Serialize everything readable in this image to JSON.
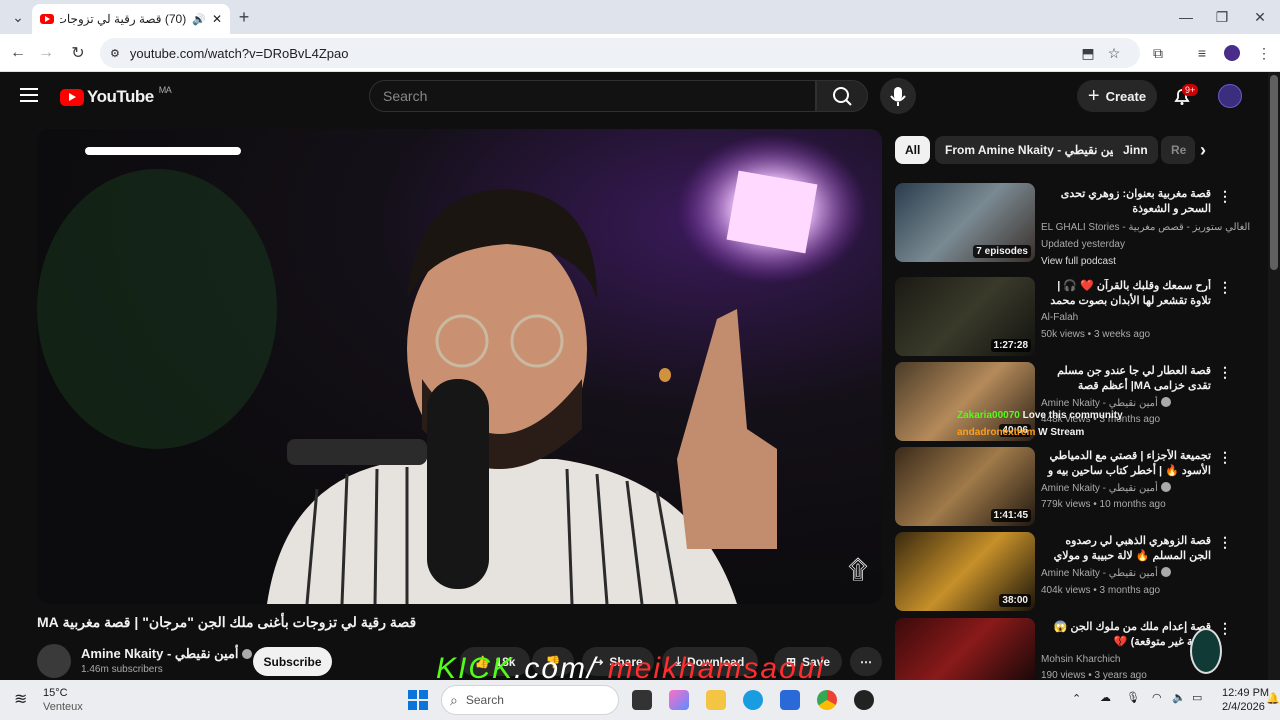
{
  "browser": {
    "tab_title": "(70) قصة رقية لي تزوجات بأغ...",
    "url": "youtube.com/watch?v=DRoBvL4Zpao"
  },
  "header": {
    "logo_text": "YouTube",
    "country": "MA",
    "search_placeholder": "Search",
    "create_label": "Create",
    "notif_count": "9+"
  },
  "video": {
    "title": "قصة رقية لي تزوجات بأغنى ملك الجن \"مرجان\" | قصة مغربية MA",
    "channel_name": "Amine Nkaity - أمين نقيطي",
    "subscribers": "1.46m subscribers",
    "subscribe_label": "Subscribe",
    "likes": "18k",
    "share_label": "Share",
    "download_label": "Download",
    "save_label": "Save",
    "overlay_text": "KICK.com/ meikhamsaoui"
  },
  "chips": [
    "All",
    "From Amine Nkaity - أمين نقيطي",
    "Jinn",
    "Re"
  ],
  "recommendations": [
    {
      "title": "قصة مغربية بعنوان: زوهري تحدى السحر و الشعوذة",
      "channel": "EL GHALI Stories - الغالي ستوريز - قصص مغربية",
      "meta": "Updated yesterday",
      "extra": "View full podcast",
      "duration": "7 episodes"
    },
    {
      "title": "أرح سمعك وقلبك بالقرآن ❤️ 🎧 | تلاوة تقشعر لها الأبدان بصوت محمد هشام |...",
      "channel": "Al-Falah",
      "meta": "50k views • 3 weeks ago",
      "duration": "1:27:28"
    },
    {
      "title": "قصة العطار لي جا عندو جن مسلم تقدى خزامى MA| أعظم قصة عشتمعها في حياتك...",
      "channel": "Amine Nkaity - أمين نقيطي",
      "meta": "448k views • 3 months ago",
      "duration": "40:06"
    },
    {
      "title": "تجميعة الأجزاء | قصتي مع الدمياطي الأسود 🔥 | أخطر كتاب ساحين بيه و ماعرفين...",
      "channel": "Amine Nkaity - أمين نقيطي",
      "meta": "779k views • 10 months ago",
      "duration": "1:41:45"
    },
    {
      "title": "قصة الزوهري الذهبي لي رصدوه الجن المسلم 🔥 لالة حبيبة و مولاي بوعزة",
      "channel": "Amine Nkaity - أمين نقيطي",
      "meta": "404k views • 3 months ago",
      "duration": "38:00"
    },
    {
      "title": "قصة إعدام ملك من ملوك الجن 😱 (نهاية غير متوقعة) 💔",
      "channel": "Mohsin Kharchich",
      "meta": "190 views • 3 years ago",
      "duration": ""
    }
  ],
  "chat_overlay": [
    {
      "user": "Zakaria00070",
      "message": "Love this community"
    },
    {
      "user": "andadronextrem",
      "message": "W Stream"
    }
  ],
  "taskbar": {
    "weather_temp": "15°C",
    "weather_desc": "Venteux",
    "search_label": "Search",
    "time": "12:49 PM",
    "date": "2/4/2026"
  }
}
